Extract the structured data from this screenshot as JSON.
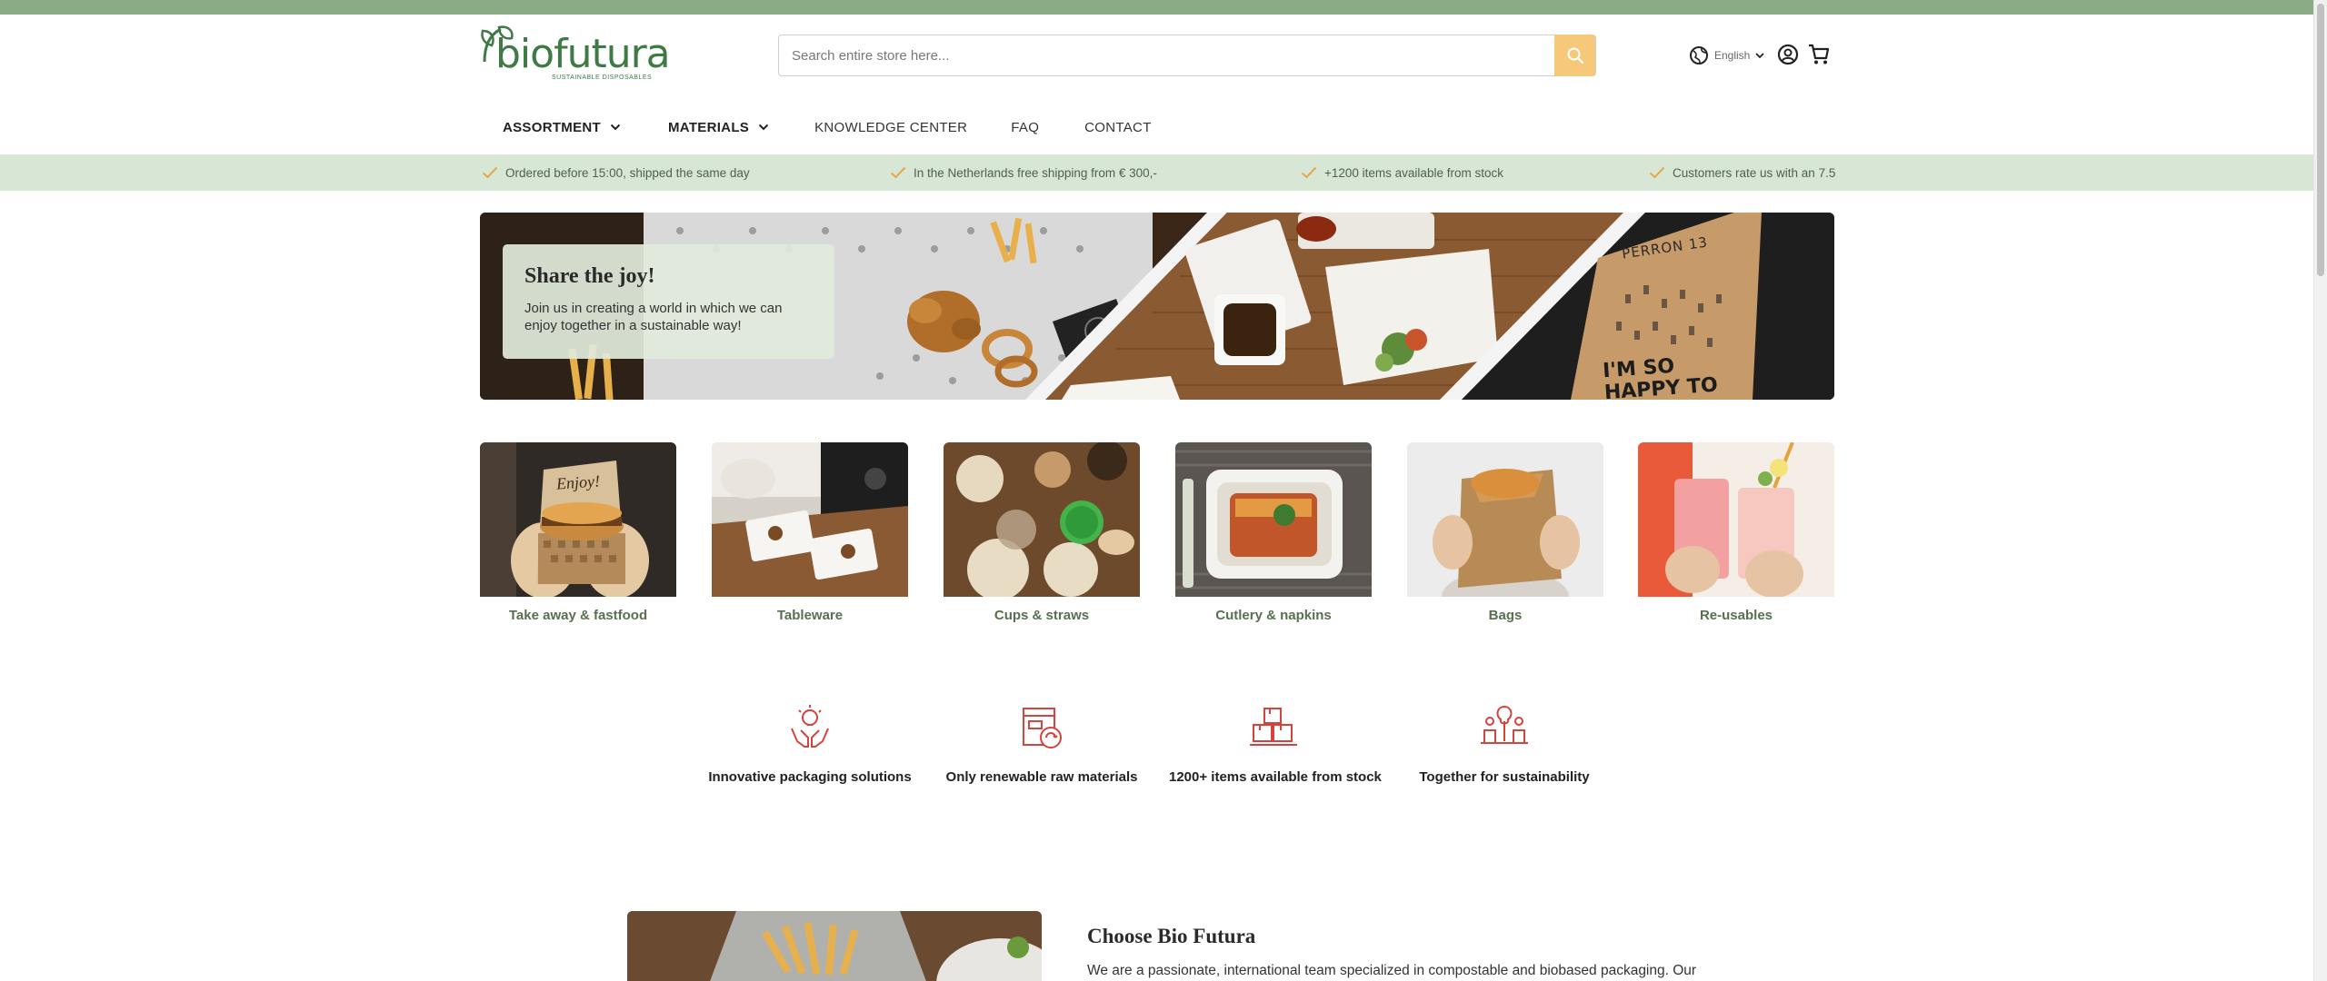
{
  "brand": {
    "name": "biofutura",
    "tagline": "SUSTAINABLE DISPOSABLES",
    "color": "#3e7a43",
    "accent": "#f6c97a"
  },
  "header": {
    "search_placeholder": "Search entire store here...",
    "language": "English",
    "icons": [
      "globe-icon",
      "chevron-down-icon",
      "account-icon",
      "cart-icon",
      "search-icon"
    ]
  },
  "nav": {
    "items": [
      {
        "label": "ASSORTMENT",
        "dropdown": true
      },
      {
        "label": "MATERIALS",
        "dropdown": true
      },
      {
        "label": "KNOWLEDGE CENTER",
        "dropdown": false
      },
      {
        "label": "FAQ",
        "dropdown": false
      },
      {
        "label": "CONTACT",
        "dropdown": false
      }
    ]
  },
  "usps": [
    "Ordered before 15:00, shipped the same day",
    "In the Netherlands free shipping from € 300,-",
    "+1200 items available from stock",
    "Customers rate us with an 7.5"
  ],
  "hero": {
    "title": "Share the joy!",
    "text": "Join us in creating a world in which we can enjoy together in a sustainable way!",
    "bag_print_1": "PERRON 13",
    "bag_print_2": "I'M SO HAPPY TO"
  },
  "categories": [
    {
      "label": "Take away & fastfood"
    },
    {
      "label": "Tableware"
    },
    {
      "label": "Cups & straws"
    },
    {
      "label": "Cutlery & napkins"
    },
    {
      "label": "Bags"
    },
    {
      "label": "Re-usables"
    }
  ],
  "category_images": {
    "box_print": "Enjoy!"
  },
  "features": [
    {
      "label": "Innovative packaging solutions",
      "icon": "hands-lightbulb-icon"
    },
    {
      "label": "Only renewable raw materials",
      "icon": "recycle-box-icon"
    },
    {
      "label": "1200+ items available from stock",
      "icon": "boxes-stock-icon"
    },
    {
      "label": "Together for sustainability",
      "icon": "people-tree-icon"
    }
  ],
  "choose": {
    "title": "Choose Bio Futura",
    "text": "We are a passionate, international team specialized in compostable and biobased packaging. Our"
  }
}
